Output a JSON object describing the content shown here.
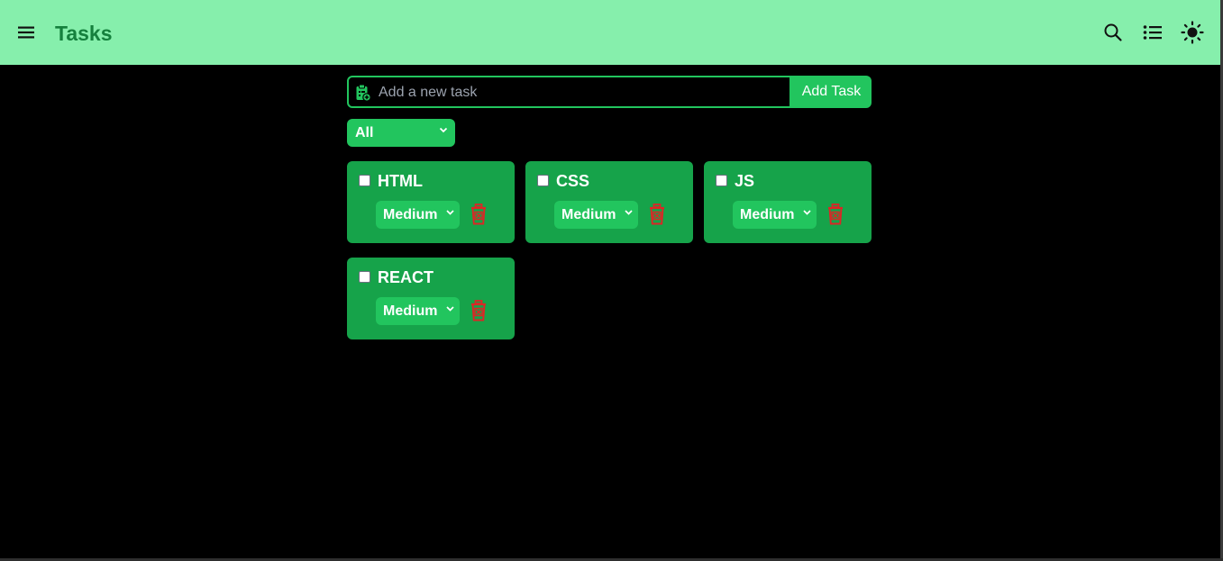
{
  "header": {
    "title": "Tasks",
    "icons": [
      "menu-icon",
      "search-icon",
      "list-icon",
      "sun-icon"
    ]
  },
  "add_task": {
    "placeholder": "Add a new task",
    "value": "",
    "button_label": "Add Task",
    "icon": "clipboard-add-icon"
  },
  "filter": {
    "selected": "All"
  },
  "tasks": [
    {
      "name": "HTML",
      "priority": "Medium",
      "completed": false
    },
    {
      "name": "CSS",
      "priority": "Medium",
      "completed": false
    },
    {
      "name": "JS",
      "priority": "Medium",
      "completed": false
    },
    {
      "name": "REACT",
      "priority": "Medium",
      "completed": false
    }
  ],
  "colors": {
    "header_bg": "#86efac",
    "title": "#15803d",
    "accent": "#22c55e",
    "card_bg": "#16a34a",
    "delete": "#dc2626",
    "page_bg": "#000000"
  }
}
